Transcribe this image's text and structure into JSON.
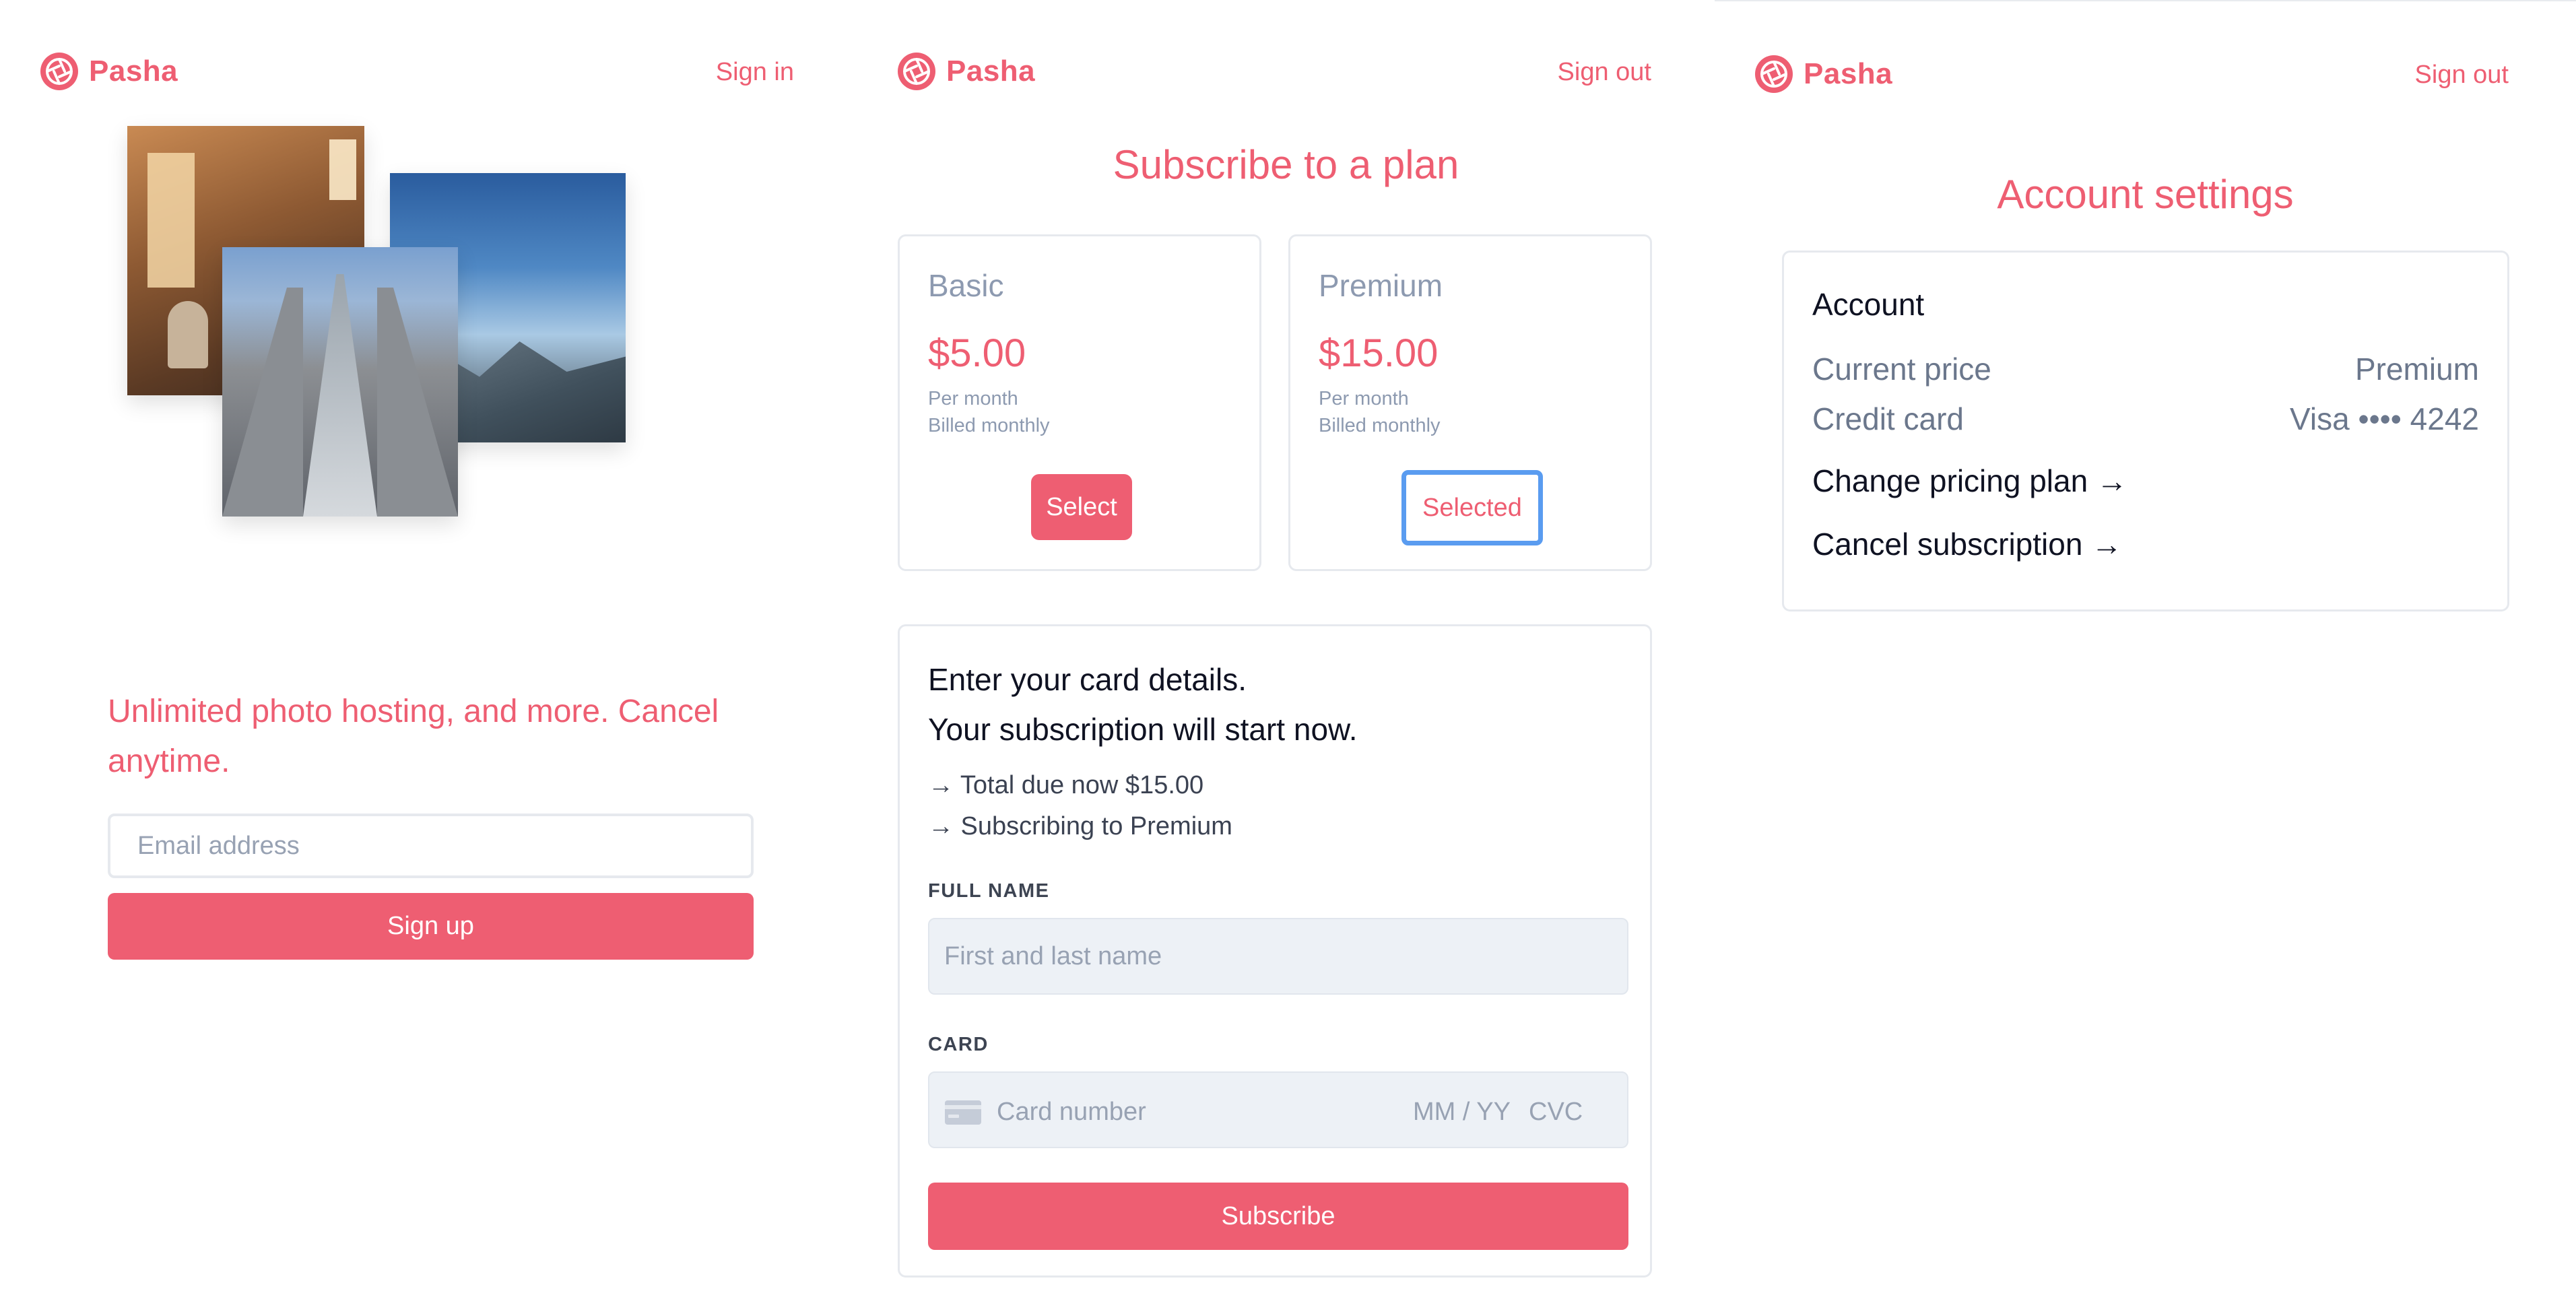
{
  "colors": {
    "accent": "#ee5e72",
    "muted": "#8d9ab0",
    "focus": "#5a9cf0",
    "field_bg": "#edf1f6"
  },
  "brand": {
    "name": "Pasha",
    "icon": "aperture-icon"
  },
  "landing": {
    "nav_link": "Sign in",
    "tagline": "Unlimited photo hosting, and more. Cancel anytime.",
    "email_placeholder": "Email address",
    "signup_label": "Sign up"
  },
  "subscribe": {
    "nav_link": "Sign out",
    "title": "Subscribe to a plan",
    "plans": [
      {
        "name": "Basic",
        "price": "$5.00",
        "period": "Per month",
        "billing": "Billed monthly",
        "button": "Select"
      },
      {
        "name": "Premium",
        "price": "$15.00",
        "period": "Per month",
        "billing": "Billed monthly",
        "button": "Selected"
      }
    ],
    "payment": {
      "line1": "Enter your card details.",
      "line2": "Your subscription will start now.",
      "total": "→ Total due now $15.00",
      "plan": "→ Subscribing to Premium",
      "full_name_label": "FULL NAME",
      "full_name_placeholder": "First and last name",
      "card_label": "CARD",
      "card_number_placeholder": "Card number",
      "card_expiry_placeholder": "MM / YY",
      "card_cvc_placeholder": "CVC",
      "subscribe_label": "Subscribe"
    }
  },
  "account": {
    "nav_link": "Sign out",
    "title": "Account settings",
    "heading": "Account",
    "rows": [
      {
        "label": "Current price",
        "value": "Premium"
      },
      {
        "label": "Credit card",
        "value": "Visa •••• 4242"
      }
    ],
    "change_plan": "Change pricing plan →",
    "cancel": "Cancel subscription →"
  }
}
